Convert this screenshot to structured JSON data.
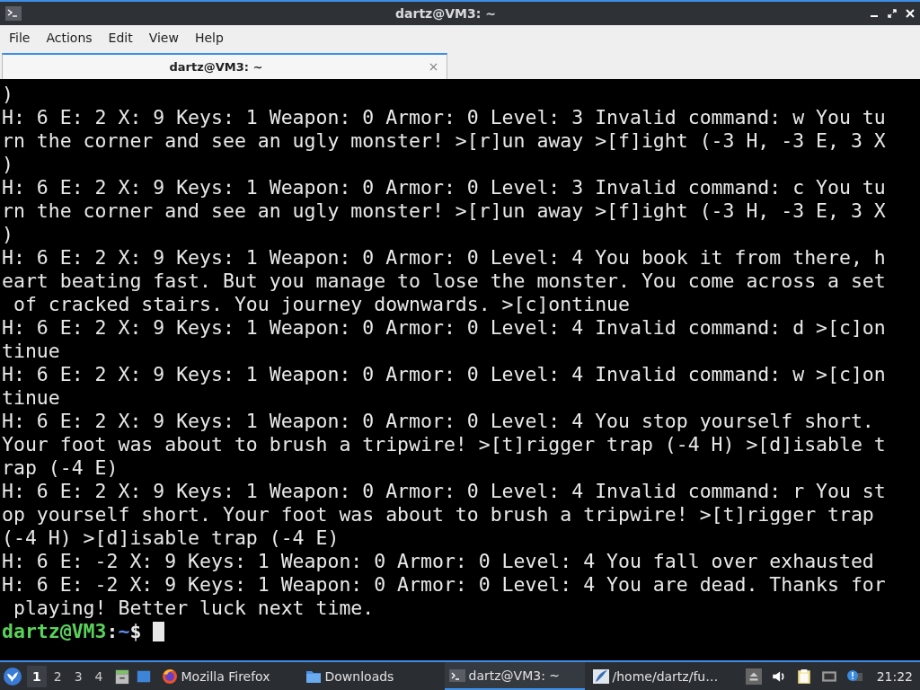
{
  "window": {
    "title": "dartz@VM3: ~"
  },
  "menu": [
    "File",
    "Actions",
    "Edit",
    "View",
    "Help"
  ],
  "tabs": [
    {
      "label": "dartz@VM3: ~",
      "selected": true
    }
  ],
  "terminal": {
    "lines": [
      ")",
      "H: 6 E: 2 X: 9 Keys: 1 Weapon: 0 Armor: 0 Level: 3 Invalid command: w You tu",
      "rn the corner and see an ugly monster! >[r]un away >[f]ight (-3 H, -3 E, 3 X",
      ")",
      "H: 6 E: 2 X: 9 Keys: 1 Weapon: 0 Armor: 0 Level: 3 Invalid command: c You tu",
      "rn the corner and see an ugly monster! >[r]un away >[f]ight (-3 H, -3 E, 3 X",
      ")",
      "H: 6 E: 2 X: 9 Keys: 1 Weapon: 0 Armor: 0 Level: 4 You book it from there, h",
      "eart beating fast. But you manage to lose the monster. You come across a set",
      " of cracked stairs. You journey downwards. >[c]ontinue",
      "H: 6 E: 2 X: 9 Keys: 1 Weapon: 0 Armor: 0 Level: 4 Invalid command: d >[c]on",
      "tinue",
      "H: 6 E: 2 X: 9 Keys: 1 Weapon: 0 Armor: 0 Level: 4 Invalid command: w >[c]on",
      "tinue",
      "H: 6 E: 2 X: 9 Keys: 1 Weapon: 0 Armor: 0 Level: 4 You stop yourself short.",
      "Your foot was about to brush a tripwire! >[t]rigger trap (-4 H) >[d]isable t",
      "rap (-4 E)",
      "H: 6 E: 2 X: 9 Keys: 1 Weapon: 0 Armor: 0 Level: 4 Invalid command: r You st",
      "op yourself short. Your foot was about to brush a tripwire! >[t]rigger trap",
      "(-4 H) >[d]isable trap (-4 E)",
      "H: 6 E: -2 X: 9 Keys: 1 Weapon: 0 Armor: 0 Level: 4 You fall over exhausted",
      "H: 6 E: -2 X: 9 Keys: 1 Weapon: 0 Armor: 0 Level: 4 You are dead. Thanks for",
      " playing! Better luck next time."
    ],
    "prompt": {
      "user_host": "dartz@VM3",
      "separator": ":",
      "path": "~",
      "symbol": "$"
    }
  },
  "taskbar": {
    "workspaces": [
      {
        "label": "1",
        "selected": true
      },
      {
        "label": "2",
        "selected": false
      },
      {
        "label": "3",
        "selected": false
      },
      {
        "label": "4",
        "selected": false
      }
    ],
    "tasks": [
      {
        "kind": "firefox",
        "label": "Mozilla Firefox",
        "selected": false
      },
      {
        "kind": "folder",
        "label": "Downloads",
        "selected": false
      },
      {
        "kind": "terminal",
        "label": "dartz@VM3: ~",
        "selected": true
      },
      {
        "kind": "editor",
        "label": "/home/dartz/fu…",
        "selected": false
      }
    ],
    "clock": "21:22"
  }
}
